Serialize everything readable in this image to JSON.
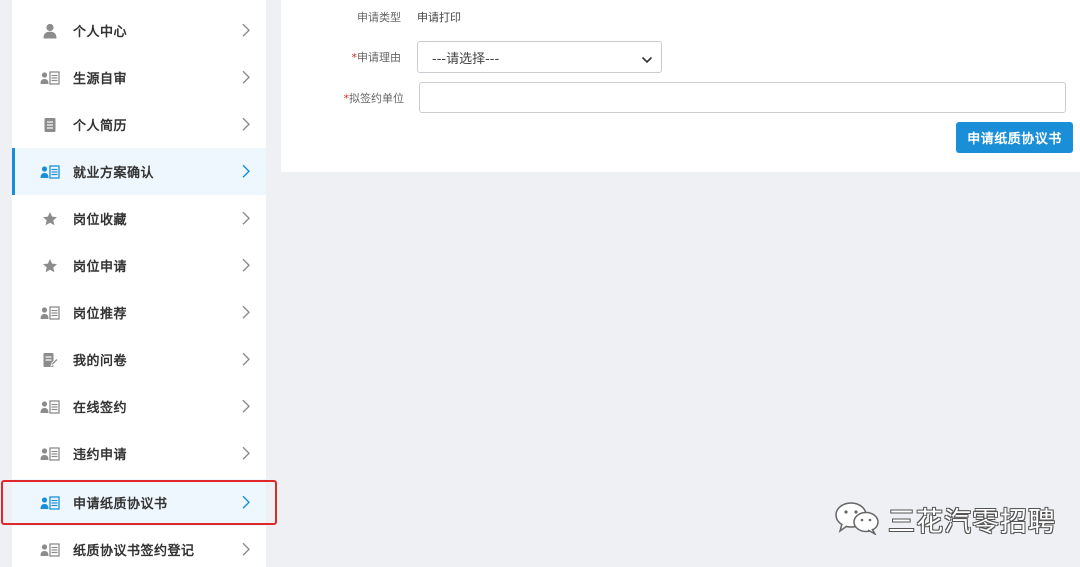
{
  "sidebar": {
    "items": [
      {
        "label": "个人中心",
        "icon": "user-icon"
      },
      {
        "label": "生源自审",
        "icon": "id-card-icon"
      },
      {
        "label": "个人简历",
        "icon": "document-icon"
      },
      {
        "label": "就业方案确认",
        "icon": "id-card-icon",
        "state": "active"
      },
      {
        "label": "岗位收藏",
        "icon": "star-icon"
      },
      {
        "label": "岗位申请",
        "icon": "star-icon"
      },
      {
        "label": "岗位推荐",
        "icon": "id-card-icon"
      },
      {
        "label": "我的问卷",
        "icon": "edit-document-icon"
      },
      {
        "label": "在线签约",
        "icon": "id-card-icon"
      },
      {
        "label": "违约申请",
        "icon": "id-card-icon"
      },
      {
        "label": "申请纸质协议书",
        "icon": "id-card-icon",
        "state": "highlighted"
      },
      {
        "label": "纸质协议书签约登记",
        "icon": "id-card-icon"
      }
    ]
  },
  "form": {
    "type_label": "申请类型",
    "type_value": "申请打印",
    "reason_label": "申请理由",
    "reason_select_value": "---请选择---",
    "unit_label": "拟签约单位",
    "unit_value": "",
    "required_mark": "*",
    "submit_label": "申请纸质协议书"
  },
  "colors": {
    "accent": "#1a8fd8",
    "highlight_border": "#e02828",
    "background": "#eef0f3"
  },
  "watermark": {
    "text": "三花汽零招聘",
    "icon": "wechat-icon"
  }
}
